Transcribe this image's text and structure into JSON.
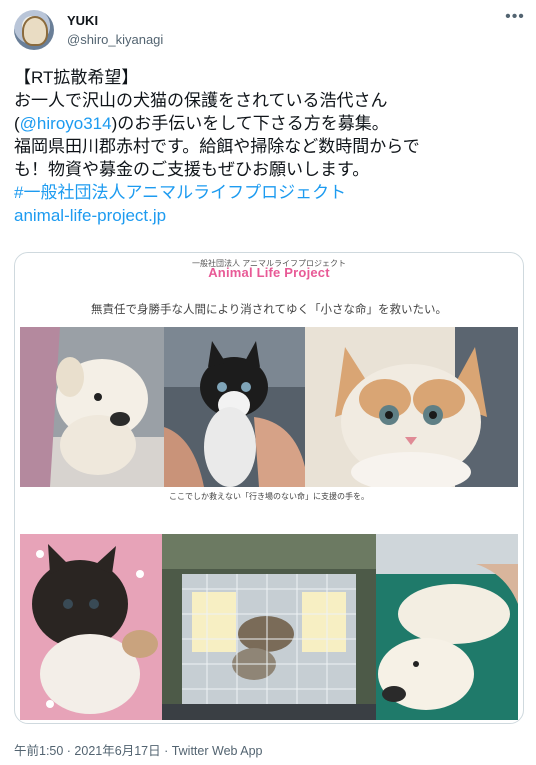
{
  "author": {
    "name": "YUKI",
    "handle": "@shiro_kiyanagi",
    "avatar_icon": "avatar-illustration-icon"
  },
  "more_icon": "more-options-icon",
  "tweet": {
    "line1": "【RT拡散希望】",
    "line2": "お一人で沢山の犬猫の保護をされている浩代さん",
    "line3_pre": "(",
    "line3_mention": "@hiroyo314",
    "line3_post": ")のお手伝いをして下さる方を募集。",
    "line4": "福岡県田川郡赤村です。給餌や掃除など数時間からで",
    "line5": "も！物資や募金のご支援もぜひお願いします。",
    "hashtag": "#一般社団法人アニマルライフプロジェクト",
    "url": "animal-life-project.jp"
  },
  "card": {
    "org_small": "一般社団法人 アニマルライフプロジェクト",
    "org_title": "Animal Life Project",
    "caption1": "無責任で身勝手な人間により消されてゆく「小さな命」を救いたい。",
    "caption2": "ここでしか救えない「行き場のない命」に支援の手を。"
  },
  "footer": {
    "timestamp": "午前1:50 · 2021年6月17日 · Twitter Web App"
  },
  "colors": {
    "link": "#1d9bf0",
    "org_title_pink": "#e85a96",
    "text": "#0f1419",
    "secondary": "#536471"
  }
}
